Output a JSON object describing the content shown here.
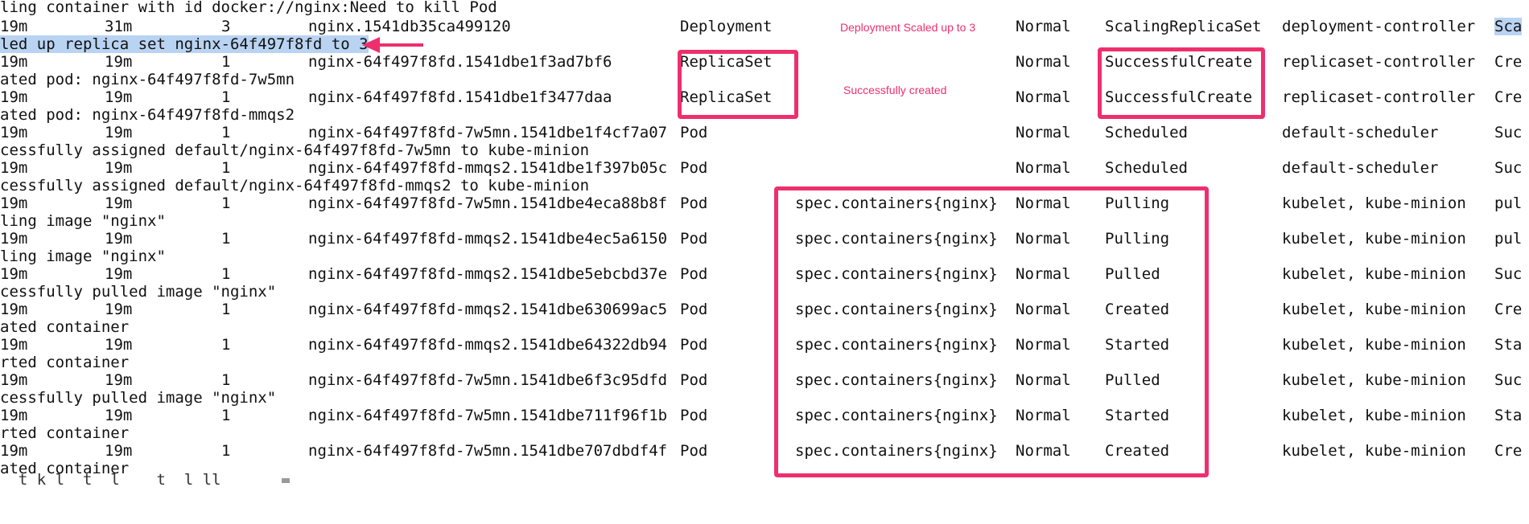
{
  "rows": [
    {
      "t": "first",
      "first": "19m",
      "last": "31m",
      "count": "3",
      "name": "nginx.1541db35ca499120",
      "kind": "Deployment",
      "subobject": "",
      "type": "Normal",
      "reason": "ScalingReplicaSet",
      "source": "deployment-controller",
      "msg_start": "Sca",
      "msg_cont": "led up replica set nginx-64f497f8fd to 3"
    },
    {
      "t": "r",
      "first": "19m",
      "last": "19m",
      "count": "1",
      "name": "nginx-64f497f8fd.1541dbe1f3ad7bf6",
      "kind": "ReplicaSet",
      "subobject": "",
      "type": "Normal",
      "reason": "SuccessfulCreate",
      "source": "replicaset-controller",
      "msg_start": "Cre",
      "msg_cont": "ated pod: nginx-64f497f8fd-7w5mn"
    },
    {
      "t": "r",
      "first": "19m",
      "last": "19m",
      "count": "1",
      "name": "nginx-64f497f8fd.1541dbe1f3477daa",
      "kind": "ReplicaSet",
      "subobject": "",
      "type": "Normal",
      "reason": "SuccessfulCreate",
      "source": "replicaset-controller",
      "msg_start": "Cre",
      "msg_cont": "ated pod: nginx-64f497f8fd-mmqs2"
    },
    {
      "t": "r",
      "first": "19m",
      "last": "19m",
      "count": "1",
      "name": "nginx-64f497f8fd-7w5mn.1541dbe1f4cf7a07",
      "kind": "Pod",
      "subobject": "",
      "type": "Normal",
      "reason": "Scheduled",
      "source": "default-scheduler",
      "msg_start": "Suc",
      "msg_cont": "cessfully assigned default/nginx-64f497f8fd-7w5mn to kube-minion"
    },
    {
      "t": "r",
      "first": "19m",
      "last": "19m",
      "count": "1",
      "name": "nginx-64f497f8fd-mmqs2.1541dbe1f397b05c",
      "kind": "Pod",
      "subobject": "",
      "type": "Normal",
      "reason": "Scheduled",
      "source": "default-scheduler",
      "msg_start": "Suc",
      "msg_cont": "cessfully assigned default/nginx-64f497f8fd-mmqs2 to kube-minion"
    },
    {
      "t": "r",
      "first": "19m",
      "last": "19m",
      "count": "1",
      "name": "nginx-64f497f8fd-7w5mn.1541dbe4eca88b8f",
      "kind": "Pod",
      "subobject": "spec.containers{nginx}",
      "type": "Normal",
      "reason": "Pulling",
      "source": "kubelet, kube-minion",
      "msg_start": "pul",
      "msg_cont": "ling image \"nginx\""
    },
    {
      "t": "r",
      "first": "19m",
      "last": "19m",
      "count": "1",
      "name": "nginx-64f497f8fd-mmqs2.1541dbe4ec5a6150",
      "kind": "Pod",
      "subobject": "spec.containers{nginx}",
      "type": "Normal",
      "reason": "Pulling",
      "source": "kubelet, kube-minion",
      "msg_start": "pul",
      "msg_cont": "ling image \"nginx\""
    },
    {
      "t": "r",
      "first": "19m",
      "last": "19m",
      "count": "1",
      "name": "nginx-64f497f8fd-mmqs2.1541dbe5ebcbd37e",
      "kind": "Pod",
      "subobject": "spec.containers{nginx}",
      "type": "Normal",
      "reason": "Pulled",
      "source": "kubelet, kube-minion",
      "msg_start": "Suc",
      "msg_cont": "cessfully pulled image \"nginx\""
    },
    {
      "t": "r",
      "first": "19m",
      "last": "19m",
      "count": "1",
      "name": "nginx-64f497f8fd-mmqs2.1541dbe630699ac5",
      "kind": "Pod",
      "subobject": "spec.containers{nginx}",
      "type": "Normal",
      "reason": "Created",
      "source": "kubelet, kube-minion",
      "msg_start": "Cre",
      "msg_cont": "ated container"
    },
    {
      "t": "r",
      "first": "19m",
      "last": "19m",
      "count": "1",
      "name": "nginx-64f497f8fd-mmqs2.1541dbe64322db94",
      "kind": "Pod",
      "subobject": "spec.containers{nginx}",
      "type": "Normal",
      "reason": "Started",
      "source": "kubelet, kube-minion",
      "msg_start": "Sta",
      "msg_cont": "rted container"
    },
    {
      "t": "r",
      "first": "19m",
      "last": "19m",
      "count": "1",
      "name": "nginx-64f497f8fd-7w5mn.1541dbe6f3c95dfd",
      "kind": "Pod",
      "subobject": "spec.containers{nginx}",
      "type": "Normal",
      "reason": "Pulled",
      "source": "kubelet, kube-minion",
      "msg_start": "Suc",
      "msg_cont": "cessfully pulled image \"nginx\""
    },
    {
      "t": "r",
      "first": "19m",
      "last": "19m",
      "count": "1",
      "name": "nginx-64f497f8fd-7w5mn.1541dbe711f96f1b",
      "kind": "Pod",
      "subobject": "spec.containers{nginx}",
      "type": "Normal",
      "reason": "Started",
      "source": "kubelet, kube-minion",
      "msg_start": "Sta",
      "msg_cont": "rted container"
    },
    {
      "t": "r",
      "first": "19m",
      "last": "19m",
      "count": "1",
      "name": "nginx-64f497f8fd-7w5mn.1541dbe707dbdf4f",
      "kind": "Pod",
      "subobject": "spec.containers{nginx}",
      "type": "Normal",
      "reason": "Created",
      "source": "kubelet, kube-minion",
      "msg_start": "Cre",
      "msg_cont": "ated container"
    }
  ],
  "header_continuation": "ling container with id docker://nginx:Need to kill Pod",
  "partial_bottom_line": "  t k l  t  l    t  l ll  ",
  "annotations": {
    "scaled": "Deployment Scaled up to 3",
    "created": "Successfully created"
  },
  "colors": {
    "accent": "#ee2f6e",
    "selection": "#b9d3f2",
    "background": "#ffffff",
    "text": "#111111"
  }
}
